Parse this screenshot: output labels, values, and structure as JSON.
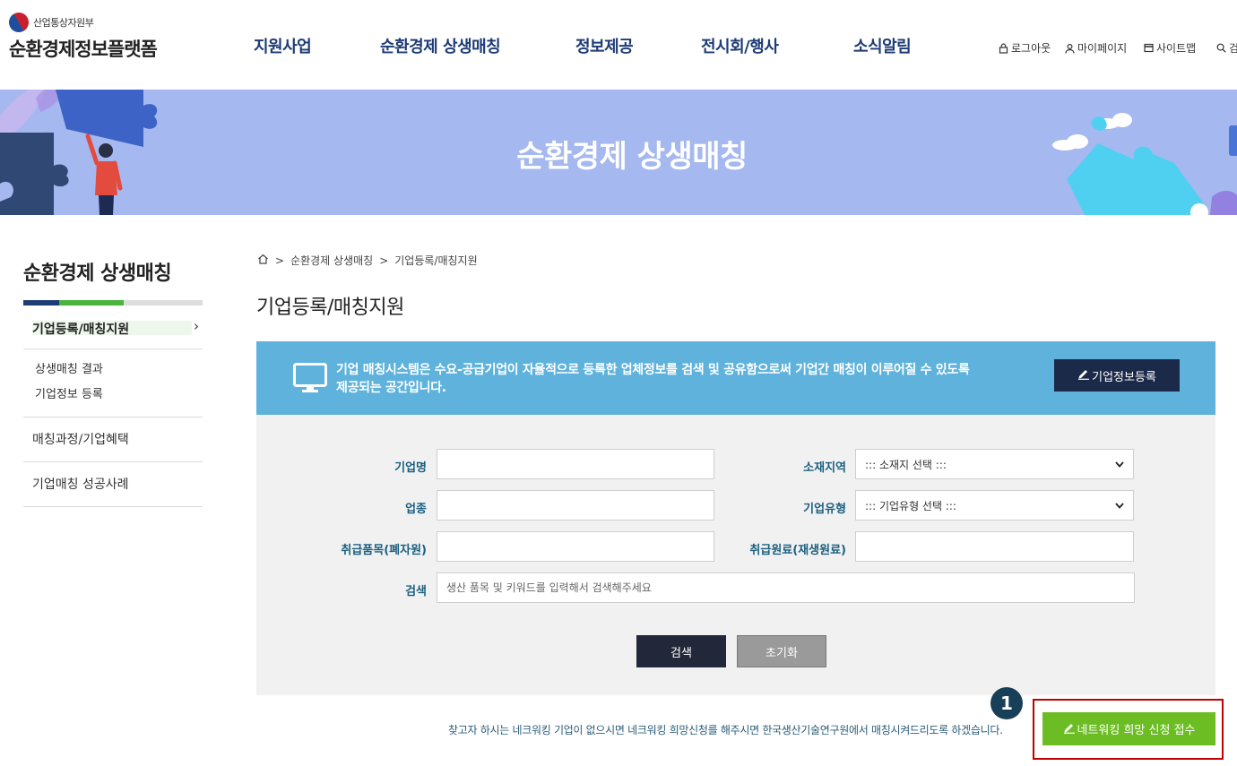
{
  "header": {
    "ministry": "산업통상자원부",
    "site_name": "순환경제정보플랫폼",
    "nav": [
      "지원사업",
      "순환경제 상생매칭",
      "정보제공",
      "전시회/행사",
      "소식알림"
    ],
    "util": {
      "logout": "로그아웃",
      "mypage": "마이페이지",
      "sitemap": "사이트맵",
      "search": "검"
    }
  },
  "hero": {
    "title": "순환경제 상생매칭"
  },
  "lnb": {
    "title": "순환경제 상생매칭",
    "active": "기업등록/매칭지원",
    "sub_items": [
      "상생매칭 결과",
      "기업정보 등록"
    ],
    "items": [
      "매칭과정/기업혜택",
      "기업매칭 성공사례"
    ]
  },
  "breadcrumb": {
    "sep": ">",
    "level1": "순환경제 상생매칭",
    "level2": "기업등록/매칭지원"
  },
  "page_title": "기업등록/매칭지원",
  "info": {
    "text_line1": "기업 매칭시스템은 수요-공급기업이 자율적으로 등록한 업체정보를 검색 및 공유함으로써 기업간 매칭이 이루어질 수 있도록",
    "text_line2": "제공되는 공간입니다.",
    "register_label": "기업정보등록"
  },
  "form": {
    "company_name_label": "기업명",
    "company_name_value": "",
    "region_label": "소재지역",
    "region_value": "::: 소재지 선택 :::",
    "industry_label": "업종",
    "industry_value": "",
    "type_label": "기업유형",
    "type_value": "::: 기업유형 선택 :::",
    "waste_label": "취급품목(폐자원)",
    "waste_value": "",
    "material_label": "취급원료(재생원료)",
    "material_value": "",
    "search_label": "검색",
    "search_placeholder": "생산 품목 및 키워드를 입력해서 검색해주세요",
    "search_button": "검색",
    "reset_button": "초기화"
  },
  "footer": {
    "note": "찾고자 하시는 네크워킹 기업이 없으시면 네크워킹 희망신청를 해주시면 한국생산기술연구원에서 매칭시켜드리도록 하겠습니다.",
    "callout_number": "1",
    "network_button": "네트워킹 희망 신청 접수"
  },
  "colors": {
    "nav": "#1d3b75",
    "hero": "#a5b8ef",
    "info_box": "#5eb2dc",
    "network_button": "#6cbd23",
    "callout_border": "#c00000"
  }
}
